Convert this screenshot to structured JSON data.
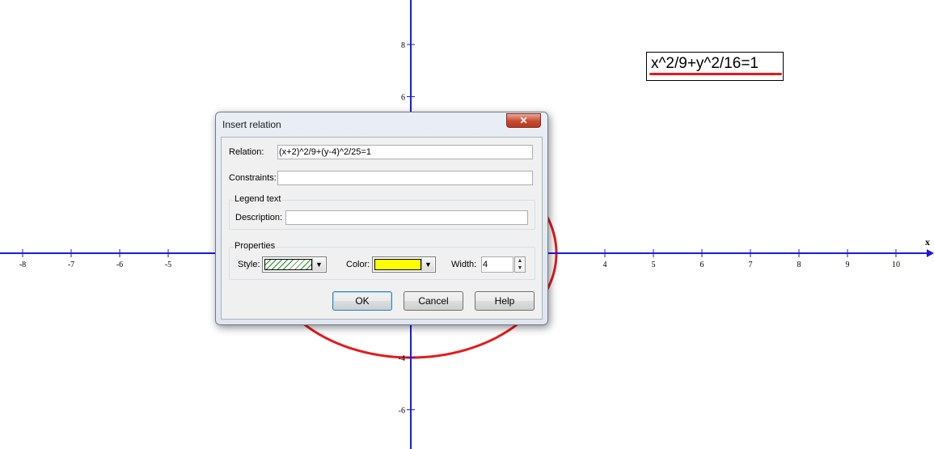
{
  "graph": {
    "x_axis_name": "x",
    "x_ticks": [
      "-8",
      "-7",
      "-6",
      "-5",
      "4",
      "5",
      "6",
      "7",
      "8",
      "9",
      "10"
    ],
    "y_ticks": [
      "8",
      "6",
      "-4",
      "-6"
    ],
    "legend_text": "x^2/9+y^2/16=1",
    "curve_color": "#e41b1b",
    "axis_color": "#1a1ae6"
  },
  "dialog": {
    "title": "Insert relation",
    "close_symbol": "✕",
    "relation_label": "Relation:",
    "relation_value": "(x+2)^2/9+(y-4)^2/25=1",
    "constraints_label": "Constraints:",
    "constraints_value": "",
    "legend_group_title": "Legend text",
    "description_label": "Description:",
    "description_value": "",
    "properties_group_title": "Properties",
    "style_label": "Style:",
    "color_label": "Color:",
    "color_value": "#ffff00",
    "width_label": "Width:",
    "width_value": "4",
    "ok_label": "OK",
    "cancel_label": "Cancel",
    "help_label": "Help"
  }
}
